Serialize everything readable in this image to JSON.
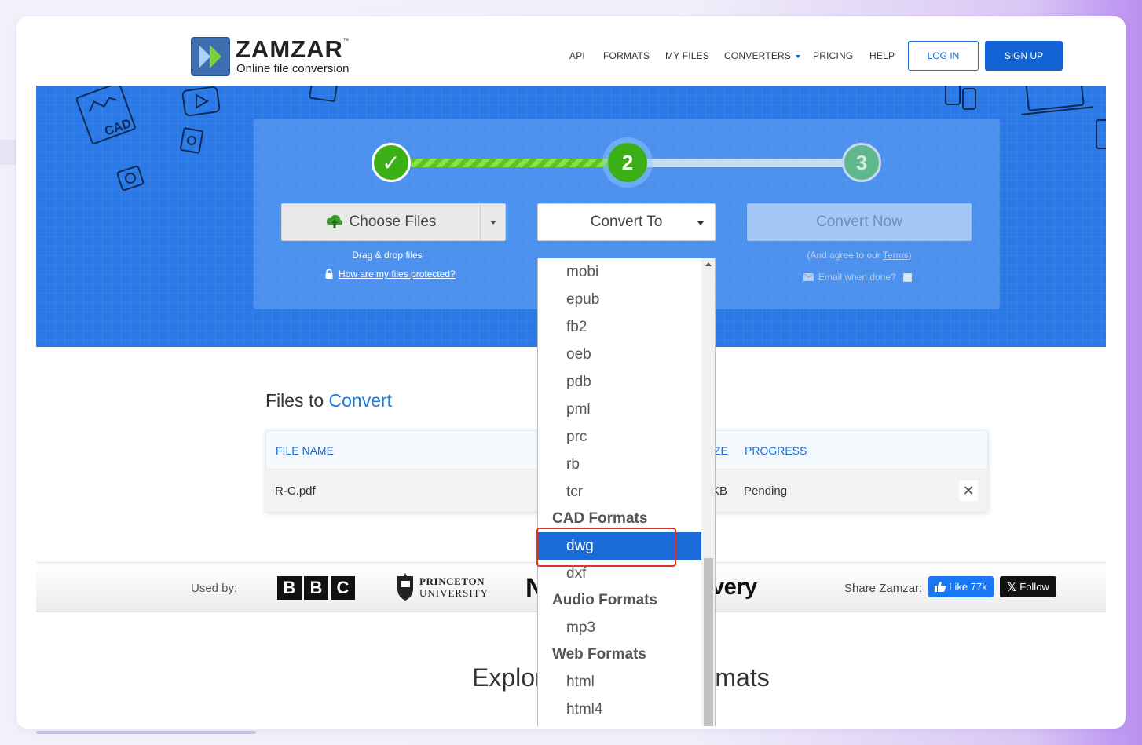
{
  "header": {
    "brand": "ZAMZAR",
    "trademark": "™",
    "tagline": "Online file conversion",
    "nav": [
      "API",
      "FORMATS",
      "MY FILES",
      "CONVERTERS",
      "PRICING",
      "HELP"
    ],
    "login_label": "LOG IN",
    "signup_label": "SIGN UP"
  },
  "hero": {
    "deco_cad_text": "CAD",
    "steps": [
      "✓",
      "2",
      "3"
    ],
    "choose_files_label": "Choose Files",
    "drag_drop_text": "Drag & drop files",
    "protect_link": "How are my files protected?",
    "convert_to_label": "Convert To",
    "convert_now_label": "Convert Now",
    "agree_prefix": "(And agree to our ",
    "terms_link": "Terms",
    "agree_suffix": ")",
    "email_label": "Email when done?"
  },
  "files": {
    "title_part1": "Files to ",
    "title_part2": "Convert",
    "headers": [
      "FILE NAME",
      "ZE",
      "PROGRESS"
    ],
    "rows": [
      {
        "name": "R-C.pdf",
        "size_fragment": "KB",
        "progress": "Pending",
        "remove": "✕"
      }
    ]
  },
  "used_by": {
    "label": "Used by:",
    "bbc": [
      "B",
      "B",
      "C"
    ],
    "princeton_line1": "PRINCETON",
    "princeton_line2": "UNIVERSITY",
    "partial_logo_left": "N",
    "partial_logo_right": "very",
    "share_label": "Share Zamzar:",
    "fb_label": "Like 77k",
    "x_icon": "𝕏",
    "x_label": "Follow"
  },
  "explore": {
    "visible_left": "Explor",
    "visible_right": "rmats"
  },
  "dropdown": {
    "items": [
      {
        "type": "option",
        "label": "mobi"
      },
      {
        "type": "option",
        "label": "epub"
      },
      {
        "type": "option",
        "label": "fb2"
      },
      {
        "type": "option",
        "label": "oeb"
      },
      {
        "type": "option",
        "label": "pdb"
      },
      {
        "type": "option",
        "label": "pml"
      },
      {
        "type": "option",
        "label": "prc"
      },
      {
        "type": "option",
        "label": "rb"
      },
      {
        "type": "option",
        "label": "tcr"
      },
      {
        "type": "group",
        "label": "CAD Formats"
      },
      {
        "type": "option",
        "label": "dwg",
        "selected": true
      },
      {
        "type": "option",
        "label": "dxf"
      },
      {
        "type": "group",
        "label": "Audio Formats"
      },
      {
        "type": "option",
        "label": "mp3"
      },
      {
        "type": "group",
        "label": "Web Formats"
      },
      {
        "type": "option",
        "label": "html"
      },
      {
        "type": "option",
        "label": "html4"
      }
    ]
  },
  "colors": {
    "accent": "#1a6bd8",
    "hero_bg": "#2a79e6",
    "step_green": "#3bb016",
    "highlight_box": "#d9362b"
  }
}
